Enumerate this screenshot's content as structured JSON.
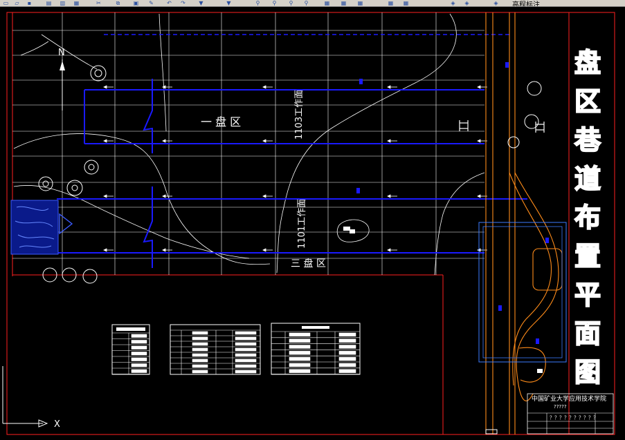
{
  "toolbar": {
    "icons": [
      "new-icon",
      "open-icon",
      "save-icon",
      "print-icon",
      "preview-icon",
      "publish-icon",
      "cut-icon",
      "copy-icon",
      "paste-icon",
      "match-icon",
      "undo-icon",
      "redo-icon",
      "pan-icon",
      "zoom-realtime-icon",
      "zoom-window-icon",
      "zoom-previous-icon",
      "properties-icon",
      "design-center-icon",
      "tool-palette-icon",
      "sheet-set-icon",
      "markup-icon",
      "calculator-icon",
      "layer-icon",
      "layer-state-icon"
    ],
    "right_label": "高程标注"
  },
  "drawing": {
    "north_label": "N",
    "zone_one_label": "一  盘  区",
    "zone_three_label": "三  盘  区",
    "face_1103": "1103工作面",
    "face_1101": "1101工作面",
    "vertical_title": [
      "盘",
      "区",
      "巷",
      "道",
      "布",
      "置",
      "平",
      "面",
      "图"
    ],
    "title_block": {
      "school": "中国矿业大学应用技术学院",
      "line2": "?????",
      "line3": "？？？？？？？？？？"
    },
    "axis_x_label": "X",
    "colors": {
      "roadway_blue": "#1a1aff",
      "grid": "#ffffff",
      "frame_red": "#ff2020",
      "shaft_orange": "#ff8c1a",
      "contour": "#ffffff"
    }
  }
}
